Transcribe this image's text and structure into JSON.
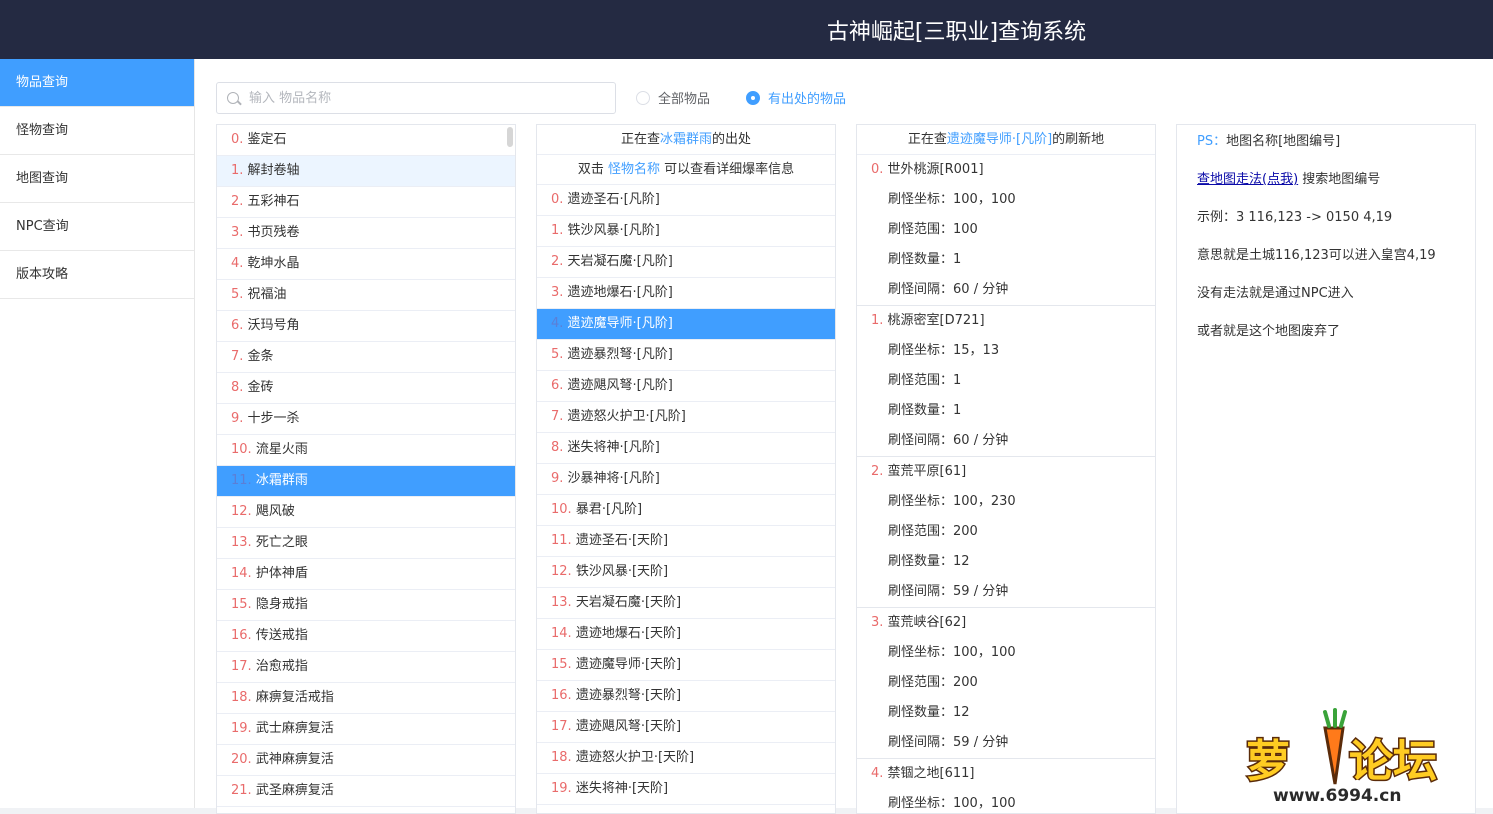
{
  "header": {
    "title": "古神崛起[三职业]查询系统"
  },
  "sidebar": {
    "items": [
      "物品查询",
      "怪物查询",
      "地图查询",
      "NPC查询",
      "版本攻略"
    ]
  },
  "search": {
    "placeholder": "输入 物品名称"
  },
  "filters": {
    "all_label": "全部物品",
    "has_source_label": "有出处的物品"
  },
  "items": [
    {
      "idx": "0.",
      "name": "鉴定石"
    },
    {
      "idx": "1.",
      "name": "解封卷轴"
    },
    {
      "idx": "2.",
      "name": "五彩神石"
    },
    {
      "idx": "3.",
      "name": "书页残卷"
    },
    {
      "idx": "4.",
      "name": "乾坤水晶"
    },
    {
      "idx": "5.",
      "name": "祝福油"
    },
    {
      "idx": "6.",
      "name": "沃玛号角"
    },
    {
      "idx": "7.",
      "name": "金条"
    },
    {
      "idx": "8.",
      "name": "金砖"
    },
    {
      "idx": "9.",
      "name": "十步一杀"
    },
    {
      "idx": "10.",
      "name": "流星火雨"
    },
    {
      "idx": "11.",
      "name": "冰霜群雨"
    },
    {
      "idx": "12.",
      "name": "飓风破"
    },
    {
      "idx": "13.",
      "name": "死亡之眼"
    },
    {
      "idx": "14.",
      "name": "护体神盾"
    },
    {
      "idx": "15.",
      "name": "隐身戒指"
    },
    {
      "idx": "16.",
      "name": "传送戒指"
    },
    {
      "idx": "17.",
      "name": "治愈戒指"
    },
    {
      "idx": "18.",
      "name": "麻痹复活戒指"
    },
    {
      "idx": "19.",
      "name": "武士麻痹复活"
    },
    {
      "idx": "20.",
      "name": "武神麻痹复活"
    },
    {
      "idx": "21.",
      "name": "武圣麻痹复活"
    }
  ],
  "source_panel": {
    "prefix": "正在查",
    "item": "冰霜群雨",
    "suffix": "的出处",
    "hint_pre": "双击 ",
    "hint_link": "怪物名称",
    "hint_post": " 可以查看详细爆率信息",
    "monsters": [
      {
        "idx": "0.",
        "name": "遗迹圣石·[凡阶]"
      },
      {
        "idx": "1.",
        "name": "铁沙风暴·[凡阶]"
      },
      {
        "idx": "2.",
        "name": "天岩凝石魔·[凡阶]"
      },
      {
        "idx": "3.",
        "name": "遗迹地爆石·[凡阶]"
      },
      {
        "idx": "4.",
        "name": "遗迹魔导师·[凡阶]"
      },
      {
        "idx": "5.",
        "name": "遗迹暴烈弩·[凡阶]"
      },
      {
        "idx": "6.",
        "name": "遗迹飓风弩·[凡阶]"
      },
      {
        "idx": "7.",
        "name": "遗迹怒火护卫·[凡阶]"
      },
      {
        "idx": "8.",
        "name": "迷失将神·[凡阶]"
      },
      {
        "idx": "9.",
        "name": "沙暴神将·[凡阶]"
      },
      {
        "idx": "10.",
        "name": "暴君·[凡阶]"
      },
      {
        "idx": "11.",
        "name": "遗迹圣石·[天阶]"
      },
      {
        "idx": "12.",
        "name": "铁沙风暴·[天阶]"
      },
      {
        "idx": "13.",
        "name": "天岩凝石魔·[天阶]"
      },
      {
        "idx": "14.",
        "name": "遗迹地爆石·[天阶]"
      },
      {
        "idx": "15.",
        "name": "遗迹魔导师·[天阶]"
      },
      {
        "idx": "16.",
        "name": "遗迹暴烈弩·[天阶]"
      },
      {
        "idx": "17.",
        "name": "遗迹飓风弩·[天阶]"
      },
      {
        "idx": "18.",
        "name": "遗迹怒火护卫·[天阶]"
      },
      {
        "idx": "19.",
        "name": "迷失将神·[天阶]"
      }
    ]
  },
  "spawn_panel": {
    "prefix": "正在查",
    "monster": "遗迹魔导师·[凡阶]",
    "suffix": "的刷新地",
    "labels": {
      "coord": "刷怪坐标：",
      "range": "刷怪范围：",
      "count": "刷怪数量：",
      "interval": "刷怪间隔："
    },
    "maps": [
      {
        "idx": "0.",
        "name": "世外桃源[R001]",
        "coord": "100，100",
        "range": "100",
        "count": "1",
        "interval": "60 / 分钟"
      },
      {
        "idx": "1.",
        "name": "桃源密室[D721]",
        "coord": "15，13",
        "range": "1",
        "count": "1",
        "interval": "60 / 分钟"
      },
      {
        "idx": "2.",
        "name": "蛮荒平原[61]",
        "coord": "100，230",
        "range": "200",
        "count": "12",
        "interval": "59 / 分钟"
      },
      {
        "idx": "3.",
        "name": "蛮荒峡谷[62]",
        "coord": "100，100",
        "range": "200",
        "count": "12",
        "interval": "59 / 分钟"
      },
      {
        "idx": "4.",
        "name": "禁锢之地[611]",
        "coord": "100，100",
        "range": "",
        "count": "",
        "interval": ""
      }
    ]
  },
  "notes": {
    "ps_label": "PS：",
    "ps_text": "地图名称[地图编号]",
    "link_text": "查地图走法(点我)",
    "link_after": " 搜索地图编号",
    "example": "示例：3 116,123 -> 0150 4,19",
    "meaning": "意思就是土城116,123可以进入皇宫4,19",
    "no_route": "没有走法就是通过NPC进入",
    "abandoned": "或者就是这个地图废弃了"
  },
  "watermark": {
    "brand": "萝卜论坛",
    "url": "www.6994.cn"
  },
  "colors": {
    "accent": "#409eff",
    "header_bg": "#242a42",
    "index_red": "#e96b6b"
  }
}
